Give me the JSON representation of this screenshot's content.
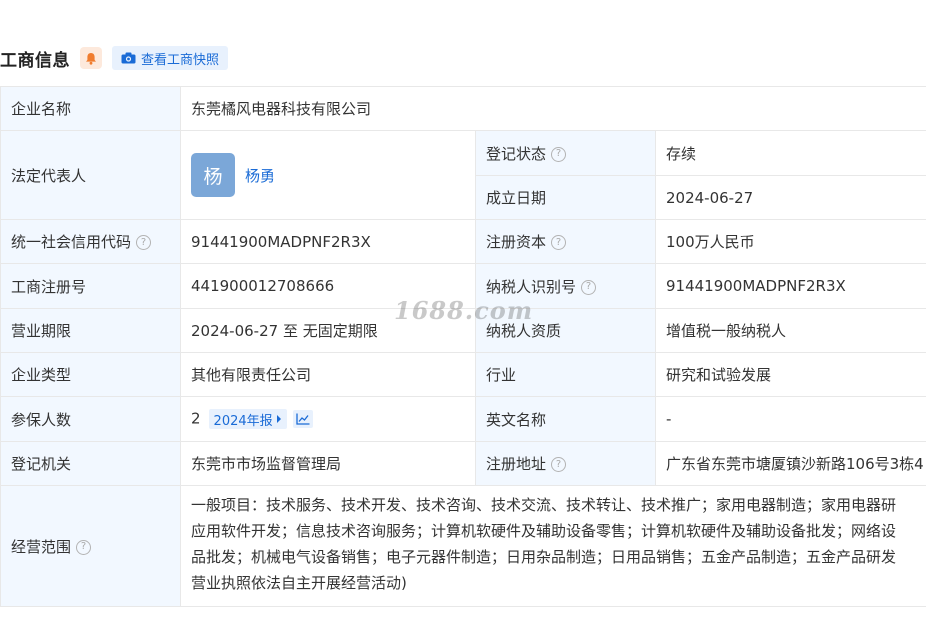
{
  "header": {
    "title": "工商信息",
    "snapshot_label": "查看工商快照"
  },
  "rows": {
    "company_name": {
      "label": "企业名称",
      "value": "东莞橘风电器科技有限公司"
    },
    "legal_rep": {
      "label": "法定代表人",
      "avatar_char": "杨",
      "name": "杨勇"
    },
    "reg_status": {
      "label": "登记状态",
      "value": "存续"
    },
    "found_date": {
      "label": "成立日期",
      "value": "2024-06-27"
    },
    "credit_code": {
      "label": "统一社会信用代码",
      "value": "91441900MADPNF2R3X"
    },
    "reg_capital": {
      "label": "注册资本",
      "value": "100万人民币"
    },
    "reg_no": {
      "label": "工商注册号",
      "value": "441900012708666"
    },
    "taxpayer_id": {
      "label": "纳税人识别号",
      "value": "91441900MADPNF2R3X"
    },
    "biz_term": {
      "label": "营业期限",
      "value": "2024-06-27 至 无固定期限"
    },
    "tax_qual": {
      "label": "纳税人资质",
      "value": "增值税一般纳税人"
    },
    "company_type": {
      "label": "企业类型",
      "value": "其他有限责任公司"
    },
    "industry": {
      "label": "行业",
      "value": "研究和试验发展"
    },
    "insured": {
      "label": "参保人数",
      "value": "2",
      "report_label": "2024年报"
    },
    "english_name": {
      "label": "英文名称",
      "value": "-"
    },
    "reg_authority": {
      "label": "登记机关",
      "value": "东莞市市场监督管理局"
    },
    "reg_address": {
      "label": "注册地址",
      "value": "广东省东莞市塘厦镇沙新路106号3栋4"
    },
    "scope": {
      "label": "经营范围",
      "lines": [
        "一般项目：技术服务、技术开发、技术咨询、技术交流、技术转让、技术推广；家用电器制造；家用电器研",
        "应用软件开发；信息技术咨询服务；计算机软硬件及辅助设备零售；计算机软硬件及辅助设备批发；网络设",
        "品批发；机械电气设备销售；电子元器件制造；日用杂品制造；日用品销售；五金产品制造；五金产品研发",
        "营业执照依法自主开展经营活动)"
      ]
    }
  },
  "help_glyph": "?",
  "watermark": "1688.com",
  "colors": {
    "label_bg": "#f2f8ff",
    "link": "#1a6bd6",
    "status_green": "#18a058",
    "avatar_bg": "#7ba7d8"
  },
  "icons": [
    "bell-icon",
    "camera-icon",
    "help-icon",
    "chevron-right-icon",
    "line-chart-icon"
  ]
}
